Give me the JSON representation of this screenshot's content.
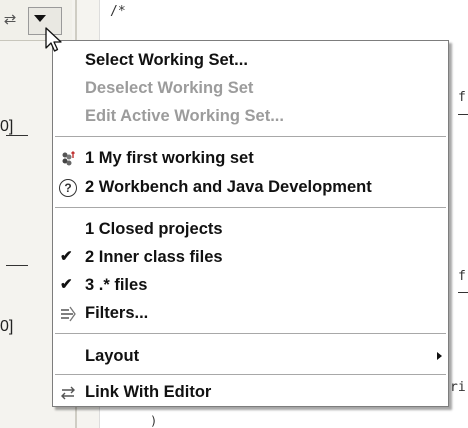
{
  "toolbar": {
    "sync_icon": "sync-arrows-icon",
    "menu_arrow_icon": "view-menu-arrow-icon"
  },
  "tree_fragments": [
    "0]",
    "0]"
  ],
  "editor": {
    "line1": "/*",
    "frag_f1": "f",
    "frag_f2": "f",
    "frag_ri": "ri",
    "frag_brace": ")"
  },
  "menu": {
    "select_working_set": "Select Working Set...",
    "deselect_working_set": "Deselect Working Set",
    "edit_active_working_set": "Edit Active Working Set...",
    "working_set_1": "1 My first working set",
    "working_set_2": "2 Workbench and Java Development",
    "filter_closed_projects": "1 Closed projects",
    "filter_inner_class": "2 Inner class files",
    "filter_dot_files": "3 .* files",
    "filters": "Filters...",
    "layout": "Layout",
    "link_with_editor": "Link With Editor",
    "check_mark": "✔",
    "help_glyph": "?"
  },
  "colors": {
    "disabled_text": "#9c9c9c",
    "menu_border": "#7d7d7d",
    "panel_bg": "#f4f3ef"
  }
}
